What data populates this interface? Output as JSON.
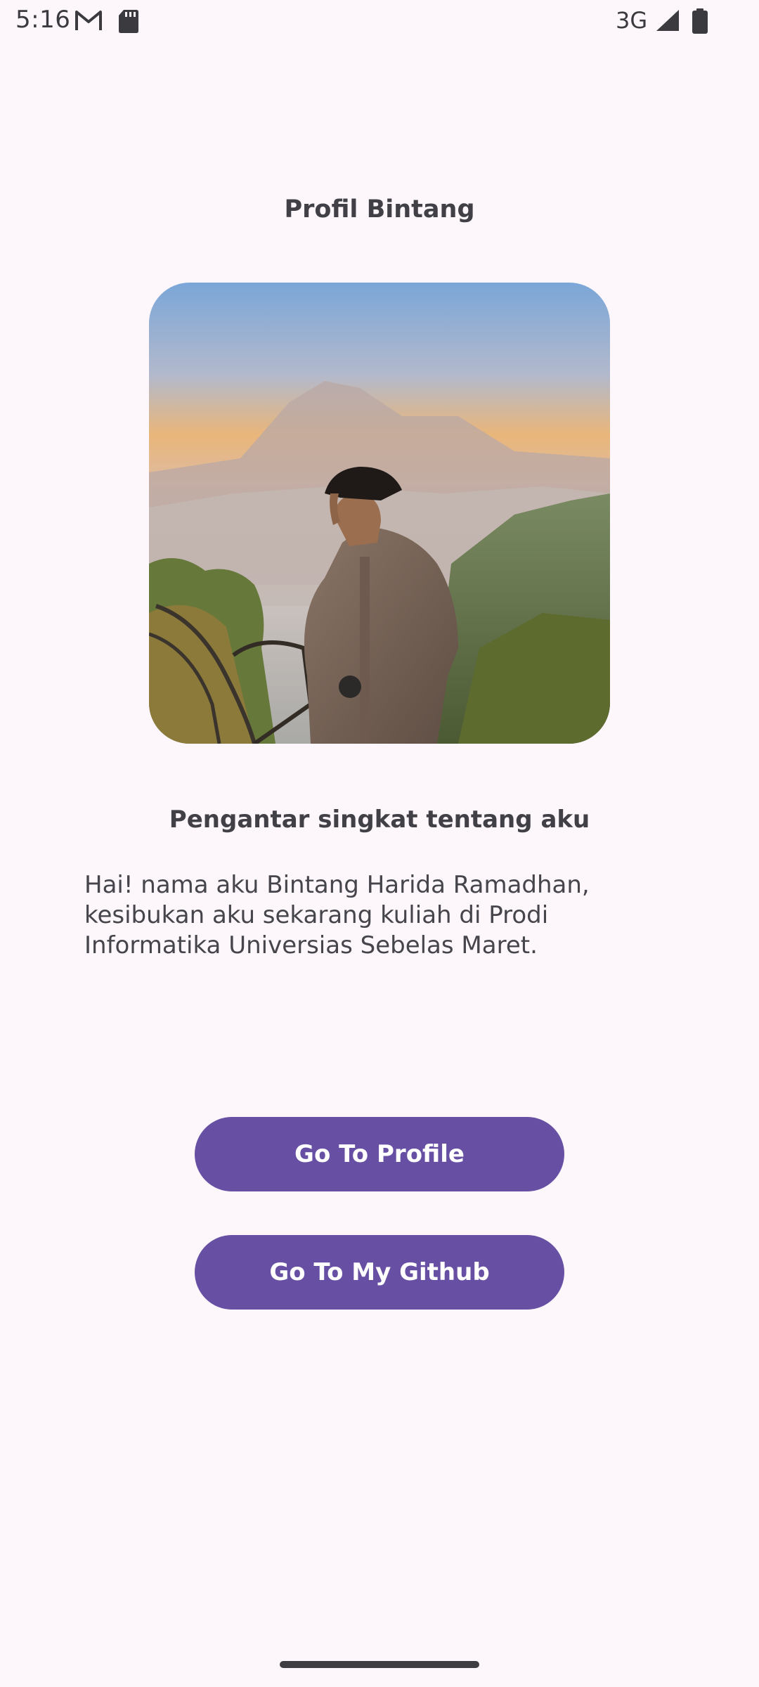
{
  "status_bar": {
    "time": "5:16",
    "network": "3G",
    "icons": [
      "gmail-icon",
      "sd-card-icon",
      "signal-icon",
      "battery-icon"
    ]
  },
  "page": {
    "title": "Profil Bintang"
  },
  "profile_photo": {
    "description_icon": "profile-photo"
  },
  "intro": {
    "heading": "Pengantar singkat tentang aku",
    "body": "Hai! nama aku Bintang Harida Ramadhan, kesibukan aku sekarang kuliah di Prodi Informatika Universias Sebelas Maret."
  },
  "buttons": {
    "profile_label": "Go To Profile",
    "github_label": "Go To My Github"
  },
  "colors": {
    "background": "#fdf7fc",
    "primary": "#6750a4",
    "text": "#404046"
  }
}
